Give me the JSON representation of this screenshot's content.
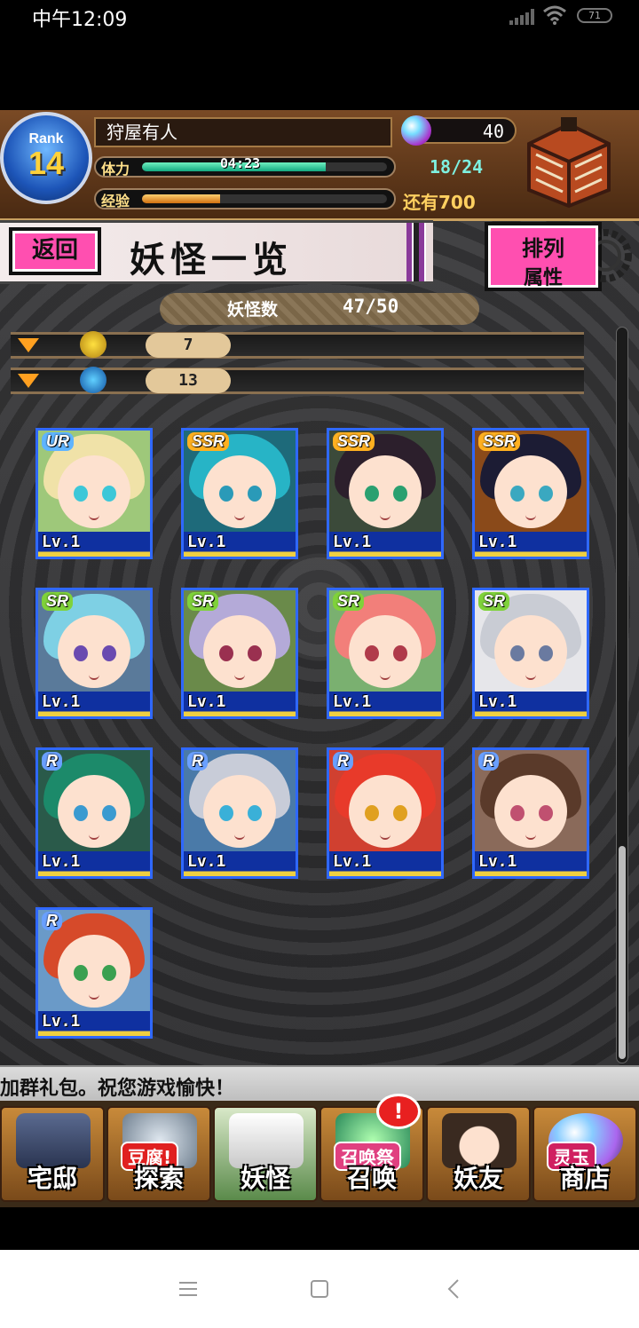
{
  "status_bar": {
    "time": "中午12:09",
    "battery": "71"
  },
  "header": {
    "rank_label": "Rank",
    "rank_value": "14",
    "player_name": "狩屋有人",
    "gems": "40",
    "stamina_label": "体力",
    "stamina_timer": "04:23",
    "stamina_count": "18/24",
    "stamina_fill": 0.75,
    "exp_label": "经验",
    "exp_fill": 0.32,
    "exp_remaining": "还有700"
  },
  "title_bar": {
    "back_label": "返回",
    "title": "妖怪一览",
    "sort_line1": "排列",
    "sort_line2": "属性"
  },
  "monster_count": {
    "label": "妖怪数",
    "value": "47/50"
  },
  "filters": [
    {
      "count": "7",
      "icon": "yellow-attribute-icon"
    },
    {
      "count": "13",
      "icon": "blue-attribute-icon"
    }
  ],
  "cards": [
    {
      "rarity": "UR",
      "level": "Lv.1",
      "hair": "#f0e2a8",
      "eye": "#3cc7d8",
      "bg": "#9ec87a"
    },
    {
      "rarity": "SSR",
      "level": "Lv.1",
      "hair": "#27b4c6",
      "eye": "#2a9ab8",
      "bg": "#1e6a7a"
    },
    {
      "rarity": "SSR",
      "level": "Lv.1",
      "hair": "#2c1f2c",
      "eye": "#2aa070",
      "bg": "#3b4a3a"
    },
    {
      "rarity": "SSR",
      "level": "Lv.1",
      "hair": "#1c1c34",
      "eye": "#3aa8c0",
      "bg": "#8a4a1a"
    },
    {
      "rarity": "SR",
      "level": "Lv.1",
      "hair": "#7ed0e4",
      "eye": "#6a4ab0",
      "bg": "#5a7a9a"
    },
    {
      "rarity": "SR",
      "level": "Lv.1",
      "hair": "#b4aad8",
      "eye": "#9a3050",
      "bg": "#6a8a4a"
    },
    {
      "rarity": "SR",
      "level": "Lv.1",
      "hair": "#f27f7a",
      "eye": "#b03a4a",
      "bg": "#7ab070"
    },
    {
      "rarity": "SR",
      "level": "Lv.1",
      "hair": "#c9ccd4",
      "eye": "#6a7aa0",
      "bg": "#e6e6ea"
    },
    {
      "rarity": "R",
      "level": "Lv.1",
      "hair": "#1c8a6a",
      "eye": "#3a9ad0",
      "bg": "#2a5a4a"
    },
    {
      "rarity": "R",
      "level": "Lv.1",
      "hair": "#c8ccd8",
      "eye": "#3ab0d8",
      "bg": "#4a7aa8"
    },
    {
      "rarity": "R",
      "level": "Lv.1",
      "hair": "#e83a2a",
      "eye": "#e0a020",
      "bg": "#d04030"
    },
    {
      "rarity": "R",
      "level": "Lv.1",
      "hair": "#5a3a2a",
      "eye": "#c05070",
      "bg": "#8a6a5a"
    },
    {
      "rarity": "R",
      "level": "Lv.1",
      "hair": "#d64a2a",
      "eye": "#3aa050",
      "bg": "#6a9ac8"
    }
  ],
  "ticker_text": "加群礼包。祝您游戏愉快！",
  "bottom_nav": [
    {
      "label": "宅邸",
      "icon": "house-icon"
    },
    {
      "label": "探索",
      "icon": "explore-icon",
      "tag": "豆腐!"
    },
    {
      "label": "妖怪",
      "icon": "scroll-icon"
    },
    {
      "label": "召唤",
      "icon": "summon-icon",
      "tag": "召唤祭"
    },
    {
      "label": "妖友",
      "icon": "friend-icon"
    },
    {
      "label": "商店",
      "icon": "shop-orb-icon",
      "tag": "灵玉"
    }
  ],
  "alert_badge": "!",
  "colors": {
    "accent_pink": "#ff4fb0",
    "card_border": "#2f68ff",
    "stamina": "#13a880",
    "exp": "#d07010"
  }
}
